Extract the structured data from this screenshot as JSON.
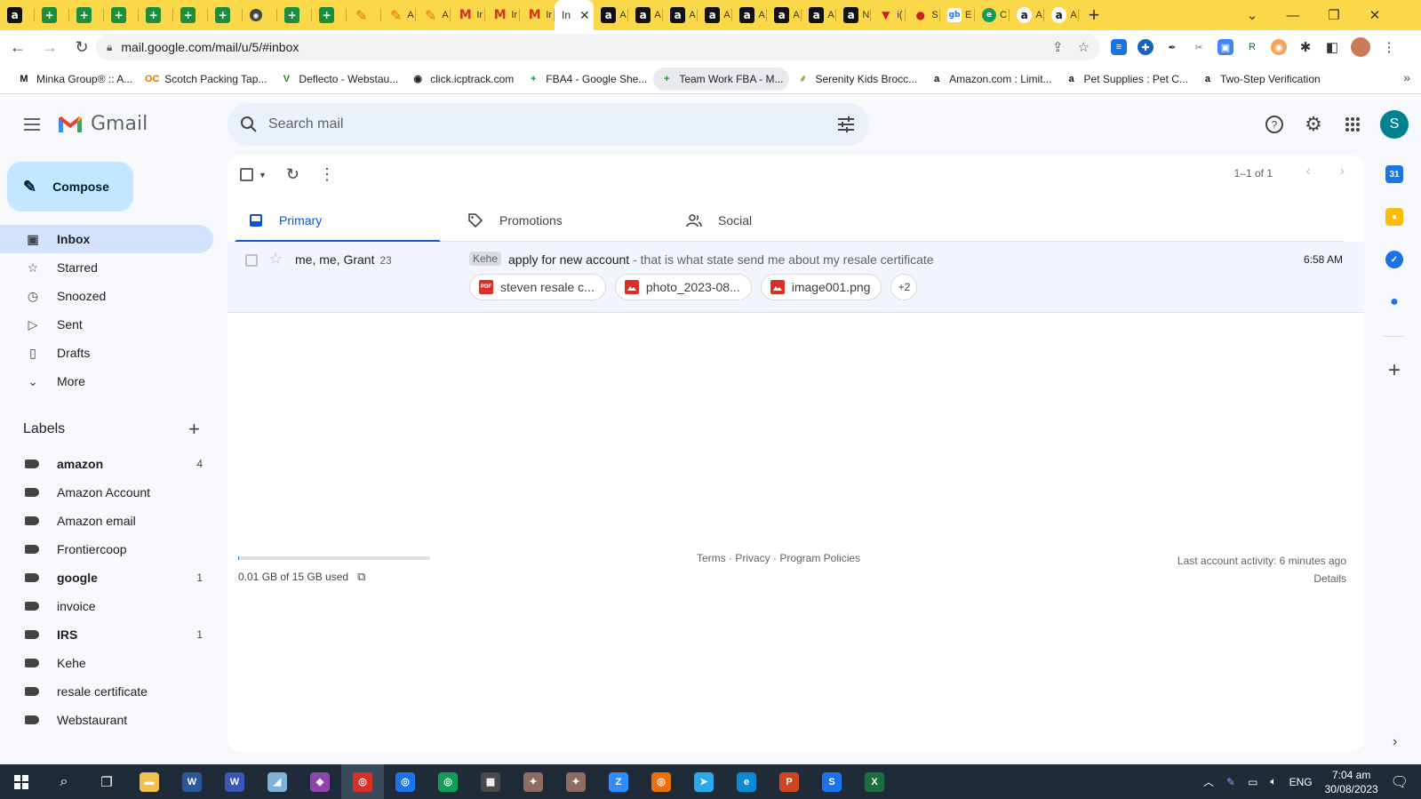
{
  "browser": {
    "tabs": [
      {
        "icon": "amazon-icon",
        "glyph": "a",
        "label": "",
        "cls": "amz"
      },
      {
        "icon": "sheets-icon",
        "glyph": "+",
        "label": "",
        "cls": "sheets"
      },
      {
        "icon": "sheets-icon",
        "glyph": "+",
        "label": "",
        "cls": "sheets"
      },
      {
        "icon": "sheets-icon",
        "glyph": "+",
        "label": "",
        "cls": "sheets"
      },
      {
        "icon": "sheets-icon",
        "glyph": "+",
        "label": "",
        "cls": "sheets"
      },
      {
        "icon": "sheets-icon",
        "glyph": "+",
        "label": "",
        "cls": "sheets"
      },
      {
        "icon": "sheets-icon",
        "glyph": "+",
        "label": "",
        "cls": "sheets"
      },
      {
        "icon": "globe-dark-icon",
        "glyph": "◉",
        "label": "",
        "cls": "dark"
      },
      {
        "icon": "sheets-icon",
        "glyph": "+",
        "label": "",
        "cls": "sheets"
      },
      {
        "icon": "sheets-icon",
        "glyph": "+",
        "label": "",
        "cls": "sheets"
      },
      {
        "icon": "pencil-icon",
        "glyph": "✎",
        "label": "",
        "cls": "pen"
      },
      {
        "icon": "pencil-icon",
        "glyph": "✎",
        "label": "A",
        "cls": "pen"
      },
      {
        "icon": "pencil-icon",
        "glyph": "✎",
        "label": "A",
        "cls": "pen"
      },
      {
        "icon": "gmail-icon",
        "glyph": "M",
        "label": "Ir",
        "cls": "gm"
      },
      {
        "icon": "gmail-icon",
        "glyph": "M",
        "label": "Ir",
        "cls": "gm"
      },
      {
        "icon": "gmail-icon",
        "glyph": "M",
        "label": "Ir",
        "cls": "gm"
      }
    ],
    "active_tab": {
      "label": "In",
      "close": "✕"
    },
    "tabs_after": [
      {
        "icon": "amazon-icon",
        "glyph": "a",
        "label": "A",
        "cls": "amz"
      },
      {
        "icon": "amazon-icon",
        "glyph": "a",
        "label": "A",
        "cls": "amz"
      },
      {
        "icon": "amazon-icon",
        "glyph": "a",
        "label": "A",
        "cls": "amz"
      },
      {
        "icon": "amazon-icon",
        "glyph": "a",
        "label": "A",
        "cls": "amz"
      },
      {
        "icon": "amazon-icon",
        "glyph": "a",
        "label": "A",
        "cls": "amz"
      },
      {
        "icon": "amazon-icon",
        "glyph": "a",
        "label": "A",
        "cls": "amz"
      },
      {
        "icon": "amazon-icon",
        "glyph": "a",
        "label": "A",
        "cls": "amz"
      },
      {
        "icon": "amazon-icon",
        "glyph": "a",
        "label": "N",
        "cls": "amz"
      },
      {
        "icon": "shield-red-icon",
        "glyph": "▼",
        "label": "i(",
        "cls": "red"
      },
      {
        "icon": "map-pin-icon",
        "glyph": "●",
        "label": "S",
        "cls": "red"
      },
      {
        "icon": "gb-icon",
        "glyph": "gb",
        "label": "E",
        "cls": "gb"
      },
      {
        "icon": "edge-icon",
        "glyph": "e",
        "label": "C",
        "cls": "edge"
      },
      {
        "icon": "amazon-white-icon",
        "glyph": "a",
        "label": "A",
        "cls": "amzw"
      },
      {
        "icon": "amazon-white-icon",
        "glyph": "a",
        "label": "A",
        "cls": "amzw"
      }
    ],
    "new_tab": "+",
    "url": "mail.google.com/mail/u/5/#inbox"
  },
  "bookmarks": [
    {
      "label": "Minka Group® :: A...",
      "glyph": "M",
      "color": "#111111",
      "hl": false
    },
    {
      "label": "Scotch Packing Tap...",
      "glyph": "OC",
      "color": "#e37400",
      "hl": false
    },
    {
      "label": "Deflecto - Webstau...",
      "glyph": "V",
      "color": "#2e7d32",
      "hl": false
    },
    {
      "label": "click.icptrack.com",
      "glyph": "◉",
      "color": "#202124",
      "hl": false
    },
    {
      "label": "FBA4 - Google She...",
      "glyph": "+",
      "color": "#1e8e3e",
      "hl": false
    },
    {
      "label": "Team Work FBA - M...",
      "glyph": "+",
      "color": "#1e8e3e",
      "hl": true
    },
    {
      "label": "Serenity Kids Brocc...",
      "glyph": "⸙",
      "color": "#7cb342",
      "hl": false
    },
    {
      "label": "Amazon.com : Limit...",
      "glyph": "a",
      "color": "#111111",
      "hl": false
    },
    {
      "label": "Pet Supplies : Pet C...",
      "glyph": "a",
      "color": "#111111",
      "hl": false
    },
    {
      "label": "Two-Step Verification",
      "glyph": "a",
      "color": "#111111",
      "hl": false
    }
  ],
  "gmail": {
    "wordmark": "Gmail",
    "search_placeholder": "Search mail",
    "profile_initial": "S",
    "compose_label": "Compose",
    "nav": [
      {
        "label": "Inbox",
        "icon": "inbox-icon",
        "glyph": "▣",
        "active": true
      },
      {
        "label": "Starred",
        "icon": "star-icon",
        "glyph": "☆",
        "active": false
      },
      {
        "label": "Snoozed",
        "icon": "clock-icon",
        "glyph": "◷",
        "active": false
      },
      {
        "label": "Sent",
        "icon": "send-icon",
        "glyph": "▷",
        "active": false
      },
      {
        "label": "Drafts",
        "icon": "draft-icon",
        "glyph": "▯",
        "active": false
      },
      {
        "label": "More",
        "icon": "chevron-down-icon",
        "glyph": "⌄",
        "active": false
      }
    ],
    "labels_title": "Labels",
    "labels": [
      {
        "name": "amazon",
        "count": "4",
        "bold": true
      },
      {
        "name": "Amazon Account",
        "count": "",
        "bold": false
      },
      {
        "name": "Amazon email",
        "count": "",
        "bold": false
      },
      {
        "name": "Frontiercoop",
        "count": "",
        "bold": false
      },
      {
        "name": "google",
        "count": "1",
        "bold": true
      },
      {
        "name": "invoice",
        "count": "",
        "bold": false
      },
      {
        "name": "IRS",
        "count": "1",
        "bold": true
      },
      {
        "name": "Kehe",
        "count": "",
        "bold": false
      },
      {
        "name": "resale certificate",
        "count": "",
        "bold": false
      },
      {
        "name": "Webstaurant",
        "count": "",
        "bold": false
      }
    ],
    "pager": "1–1 of 1",
    "tabs": [
      {
        "label": "Primary",
        "icon": "inbox-icon",
        "active": true
      },
      {
        "label": "Promotions",
        "icon": "tag-icon",
        "active": false
      },
      {
        "label": "Social",
        "icon": "people-icon",
        "active": false
      }
    ],
    "email": {
      "sender": "me, me, Grant",
      "count": "23",
      "label": "Kehe",
      "subject": "apply for new account",
      "snippet": " - that is what state send me about my resale certificate",
      "time": "6:58 AM",
      "attachments": [
        {
          "name": "steven resale c...",
          "type": "PDF"
        },
        {
          "name": "photo_2023-08...",
          "type": "IMG"
        },
        {
          "name": "image001.png",
          "type": "IMG"
        }
      ],
      "more_attachments": "+2"
    },
    "storage": {
      "text": "0.01 GB of 15 GB used",
      "fraction": 0.001
    },
    "footer": "Terms · Privacy · Program Policies",
    "activity": "Last account activity: 6 minutes ago",
    "details": "Details"
  },
  "taskbar": {
    "items": [
      {
        "icon": "file-explorer-icon",
        "glyph": "▬",
        "color": "#f0c24b"
      },
      {
        "icon": "word-icon",
        "glyph": "W",
        "color": "#2b579a"
      },
      {
        "icon": "word-icon",
        "glyph": "W",
        "color": "#3956b8"
      },
      {
        "icon": "notes-icon",
        "glyph": "◢",
        "color": "#7fb2d8"
      },
      {
        "icon": "app-badge-icon",
        "glyph": "◆",
        "color": "#8e44ad"
      },
      {
        "icon": "chrome-icon",
        "glyph": "◎",
        "color": "#d93025"
      },
      {
        "icon": "chrome-icon",
        "glyph": "◎",
        "color": "#1a73e8"
      },
      {
        "icon": "chrome-icon",
        "glyph": "◎",
        "color": "#0f9d58"
      },
      {
        "icon": "calculator-icon",
        "glyph": "▦",
        "color": "#4a4a4a"
      },
      {
        "icon": "photo-app-icon",
        "glyph": "✦",
        "color": "#8d6e63"
      },
      {
        "icon": "photo-app-icon",
        "glyph": "✦",
        "color": "#8d6e63"
      },
      {
        "icon": "zoom-icon",
        "glyph": "Z",
        "color": "#2d8cff"
      },
      {
        "icon": "chrome-icon",
        "glyph": "◎",
        "color": "#e8710a"
      },
      {
        "icon": "telegram-icon",
        "glyph": "➤",
        "color": "#29a9eb"
      },
      {
        "icon": "edge-icon",
        "glyph": "e",
        "color": "#0c8ad6"
      },
      {
        "icon": "powerpoint-icon",
        "glyph": "P",
        "color": "#d04423"
      },
      {
        "icon": "skype-icon",
        "glyph": "S",
        "color": "#1a73e8"
      },
      {
        "icon": "excel-icon",
        "glyph": "X",
        "color": "#1d6f42"
      }
    ],
    "language": "ENG",
    "time": "7:04 am",
    "date": "30/08/2023"
  }
}
